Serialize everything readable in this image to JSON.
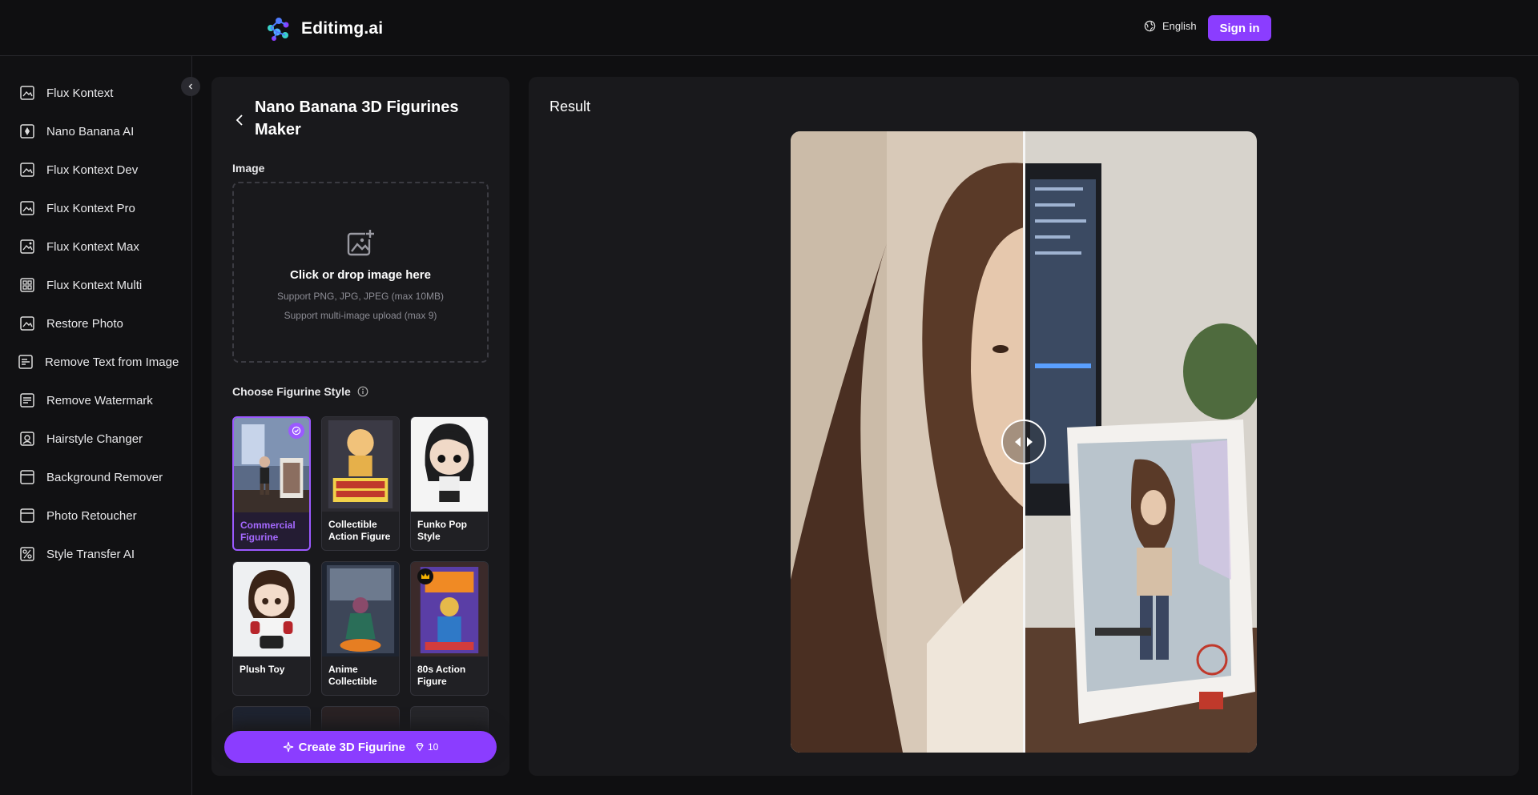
{
  "brand": {
    "name": "Editimg.ai",
    "accent": "#8b3dff"
  },
  "header": {
    "language": "English",
    "signin_label": "Sign in"
  },
  "sidebar": {
    "items": [
      {
        "label": "Flux Kontext",
        "icon": "image-icon"
      },
      {
        "label": "Nano Banana AI",
        "icon": "banana-icon"
      },
      {
        "label": "Flux Kontext Dev",
        "icon": "image-icon"
      },
      {
        "label": "Flux Kontext Pro",
        "icon": "image-icon"
      },
      {
        "label": "Flux Kontext Max",
        "icon": "image-icon"
      },
      {
        "label": "Flux Kontext Multi",
        "icon": "grid-icon"
      },
      {
        "label": "Restore Photo",
        "icon": "image-icon"
      },
      {
        "label": "Remove Text from Image",
        "icon": "text-icon"
      },
      {
        "label": "Remove Watermark",
        "icon": "watermark-icon"
      },
      {
        "label": "Hairstyle Changer",
        "icon": "hair-icon"
      },
      {
        "label": "Background Remover",
        "icon": "layers-icon"
      },
      {
        "label": "Photo Retoucher",
        "icon": "retouch-icon"
      },
      {
        "label": "Style Transfer AI",
        "icon": "style-icon"
      }
    ]
  },
  "panel": {
    "title": "Nano Banana 3D Figurines Maker",
    "image_label": "Image",
    "dropzone": {
      "main": "Click or drop image here",
      "formats": "Support PNG, JPG, JPEG (max 10MB)",
      "multi": "Support multi-image upload (max 9)"
    },
    "style_label": "Choose Figurine Style",
    "styles": [
      {
        "label": "Commercial Figurine",
        "selected": true
      },
      {
        "label": "Collectible Action Figure",
        "selected": false
      },
      {
        "label": "Funko Pop Style",
        "selected": false
      },
      {
        "label": "Plush Toy",
        "selected": false
      },
      {
        "label": "Anime Collectible",
        "selected": false
      },
      {
        "label": "80s Action Figure",
        "selected": false,
        "premium": true
      }
    ],
    "create_label": "Create 3D Figurine",
    "create_cost": "10"
  },
  "result": {
    "title": "Result"
  }
}
